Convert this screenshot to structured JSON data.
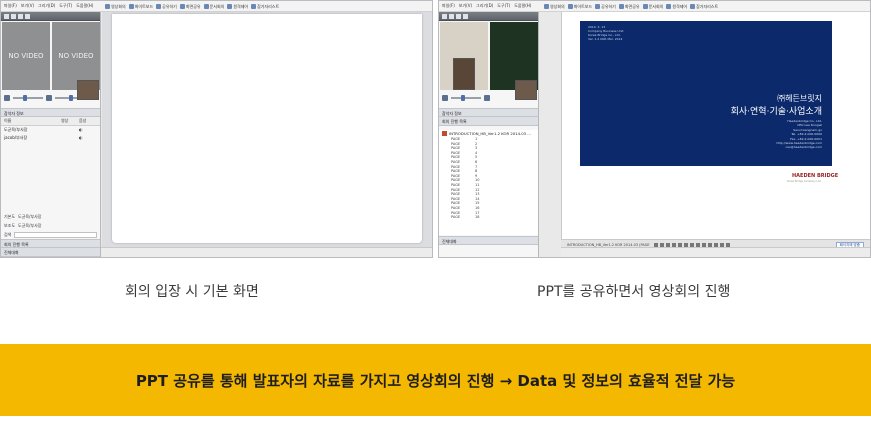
{
  "left_screenshot": {
    "menu": [
      "파일(F)",
      "보기(V)",
      "그리기(D)",
      "도구(T)",
      "도움말(H)"
    ],
    "toolbar": [
      "영상회의",
      "화이트보드",
      "공유하기",
      "화면공유",
      "문서회의",
      "원격제어",
      "참가자리스트"
    ],
    "video_tiles": [
      "NO VIDEO",
      "NO VIDEO"
    ],
    "participant_section": "참석자 정보",
    "participant_columns": [
      "이름",
      "영상",
      "음성"
    ],
    "participants": [
      {
        "name": "도균육/부사장",
        "video": "",
        "audio": ""
      },
      {
        "name": "jacob/부사장",
        "video": "",
        "audio": ""
      }
    ],
    "bottom_fields": [
      "기본도",
      "보조도",
      "검색"
    ],
    "bottom_values": [
      "도균육/부사장",
      "도균육/부사장"
    ],
    "sections": [
      "회의 진행 목록",
      "진체대화"
    ]
  },
  "right_screenshot": {
    "menu": [
      "파일(F)",
      "보기(V)",
      "그리기(D)",
      "도구(T)",
      "도움말(H)"
    ],
    "toolbar": [
      "영상회의",
      "화이트보드",
      "공유하기",
      "화면공유",
      "문서회의",
      "원격제어",
      "참가자리스트"
    ],
    "sections": [
      "참석자 정보",
      "회의 진행 목록",
      "진체대화"
    ],
    "file_name": "INTRODUCTION_HB_Ver1.2 KOR 2014.03 ...",
    "page_label": "PAGE",
    "page_numbers": [
      "1",
      "2",
      "3",
      "4",
      "5",
      "6",
      "7",
      "8",
      "9",
      "10",
      "11",
      "12",
      "13",
      "14",
      "15",
      "16",
      "17",
      "18"
    ],
    "slide": {
      "top_left_lines": [
        "2014. 3. 13",
        "Company Business Unit",
        "Korea Bridge Co., Ltd.",
        "Ver. 1.2 KOR Mar. 2014"
      ],
      "company": "㈜헤든브릿지",
      "title": "회사·연혁·기술·사업소개",
      "info_lines": [
        "Haedenbridge Co., Ltd.",
        "CEO Lee Dongwl",
        "Seoul Gangnam-gu",
        "Tel. +82-2-000-0000",
        "Fax. +82-2-000-0001",
        "http://www.haedenbridge.com",
        "ceo@haedenbridge.com"
      ],
      "logo": "HAEDEN BRIDGE",
      "logo_sub": "Korea Bridge Company Ltd."
    },
    "doc_toolbar_file": "INTRODUCTION_HB_Ver1.2 KOR 2014.03 (PAGE",
    "zoom": "페이지에 맞춤"
  },
  "captions": {
    "left": "회의 입장 시 기본 화면",
    "right": "PPT를 공유하면서 영상회의 진행"
  },
  "banner": {
    "text": "PPT 공유를 통해 발표자의 자료를 가지고 영상회의 진행 → Data 및 정보의 효율적 전달 가능",
    "color": "#f5b800"
  }
}
